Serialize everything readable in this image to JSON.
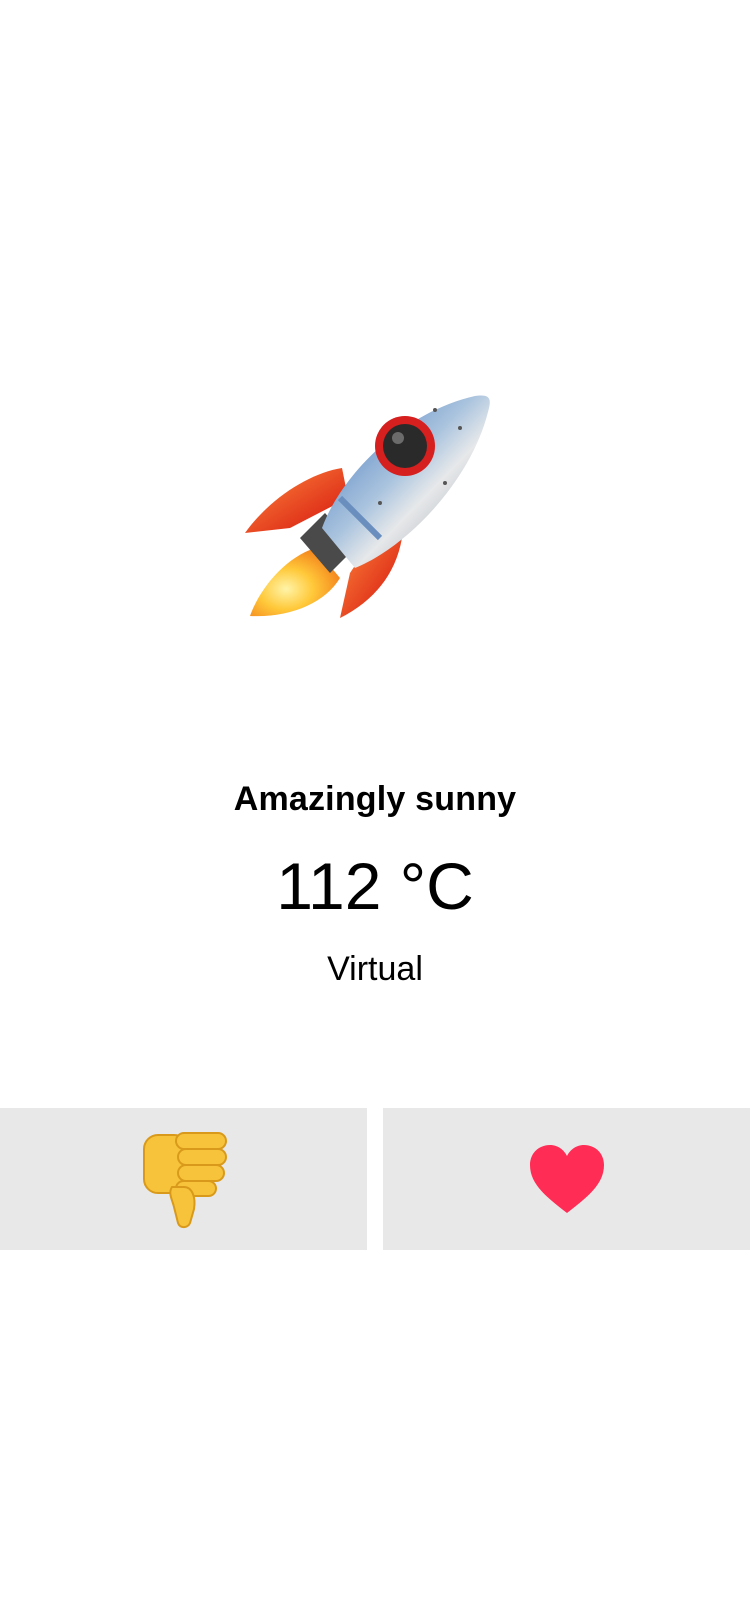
{
  "hero": {
    "icon": "rocket-icon"
  },
  "weather": {
    "condition": "Amazingly sunny",
    "temperature": "112 °C",
    "location": "Virtual"
  },
  "actions": {
    "dislike": {
      "icon": "thumbs-down-icon"
    },
    "like": {
      "icon": "heart-icon",
      "color": "#ff2d55"
    }
  },
  "colors": {
    "background": "#ffffff",
    "button_background": "#e8e8e8"
  }
}
